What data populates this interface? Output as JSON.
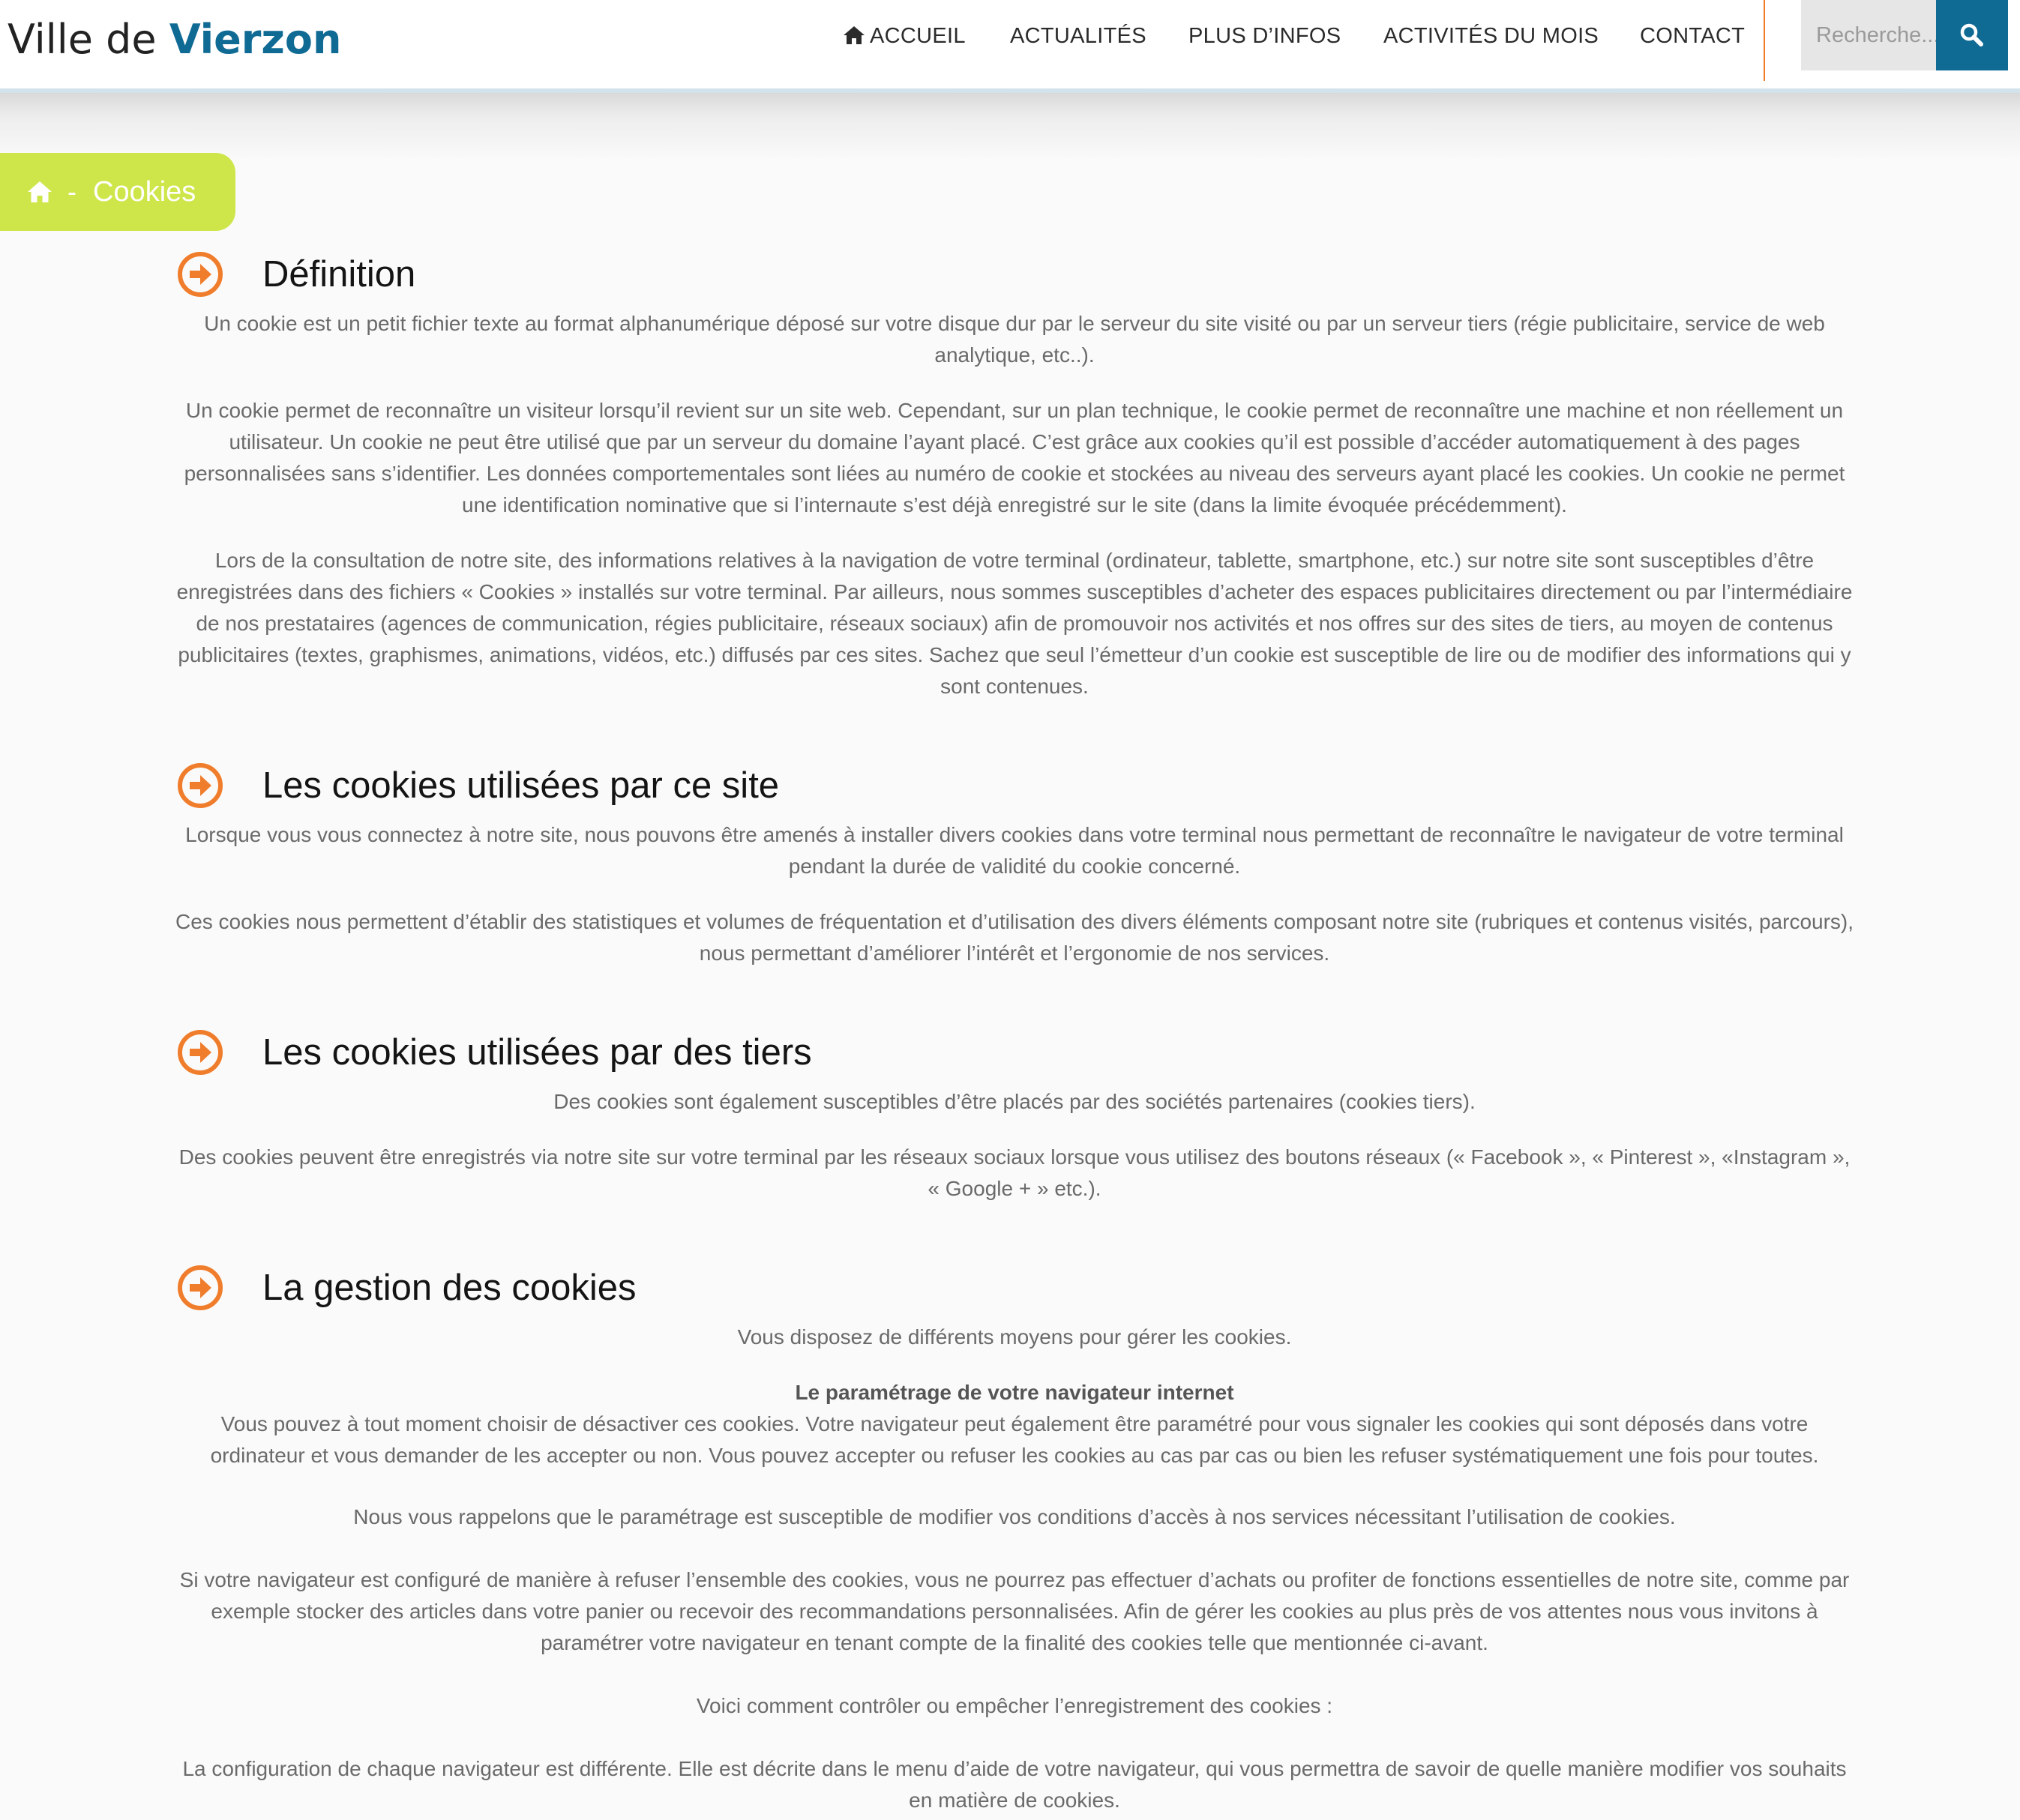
{
  "header": {
    "logo_prefix": "Ville de ",
    "logo_brand": "Vierzon",
    "nav": [
      {
        "label": "ACCUEIL",
        "icon": "home-icon"
      },
      {
        "label": "ACTUALITÉS"
      },
      {
        "label": "PLUS D’INFOS"
      },
      {
        "label": "ACTIVITÉS DU MOIS"
      },
      {
        "label": "CONTACT"
      }
    ],
    "search_placeholder": "Recherche...",
    "search_icon": "search-icon"
  },
  "breadcrumb": {
    "separator": "-",
    "current": "Cookies"
  },
  "colors": {
    "brand_blue": "#0f6a94",
    "accent_orange": "#f07d2c",
    "breadcrumb_green": "#cfe64a",
    "body_text": "#6a6a6a"
  },
  "sections": [
    {
      "title": "Définition",
      "paragraphs": [
        "Un cookie est un petit fichier texte au format alphanumérique déposé sur votre disque dur par le serveur du site visité ou par un serveur tiers (régie publicitaire, service de web analytique, etc..).",
        "Un cookie permet de reconnaître un visiteur lorsqu’il revient sur un site web. Cependant, sur un plan technique, le cookie permet de reconnaître une machine et non réellement un utilisateur. Un cookie ne peut être utilisé que par un serveur du domaine l’ayant placé. C’est grâce aux cookies qu’il est possible d’accéder automatiquement à des pages personnalisées sans s’identifier. Les données comportementales sont liées au numéro de cookie et stockées au niveau des serveurs ayant placé les cookies. Un cookie ne permet une identification nominative que si l’internaute s’est déjà enregistré sur le site (dans la limite évoquée précédemment).",
        "Lors de la consultation de notre site, des informations relatives à la navigation de votre terminal (ordinateur, tablette, smartphone, etc.) sur notre site sont susceptibles d’être enregistrées dans des fichiers « Cookies » installés sur votre terminal. Par ailleurs, nous sommes susceptibles d’acheter des espaces publicitaires directement ou par l’intermédiaire de nos prestataires (agences de communication, régies publicitaire, réseaux sociaux) afin de promouvoir nos activités et nos offres sur des sites de tiers, au moyen de contenus publicitaires (textes, graphismes, animations, vidéos, etc.) diffusés par ces sites. Sachez que seul l’émetteur d’un cookie est susceptible de lire ou de modifier des informations qui y sont contenues."
      ]
    },
    {
      "title": "Les cookies utilisées par ce site",
      "paragraphs": [
        "Lorsque vous vous connectez à notre site, nous pouvons être amenés à installer divers cookies dans votre terminal nous permettant de reconnaître le navigateur de votre terminal pendant la durée de validité du cookie concerné.",
        "Ces cookies nous permettent d’établir des statistiques et volumes de fréquentation et d’utilisation des divers éléments composant notre site (rubriques et contenus visités, parcours), nous permettant d’améliorer l’intérêt et l’ergonomie de nos services."
      ]
    },
    {
      "title": "Les cookies utilisées par des tiers",
      "paragraphs": [
        "Des cookies sont également susceptibles d’être placés par des sociétés partenaires (cookies tiers).",
        "Des cookies peuvent être enregistrés via notre site sur votre terminal par les réseaux sociaux  lorsque vous utilisez des boutons réseaux (« Facebook », « Pinterest », «Instagram », « Google + » etc.)."
      ]
    },
    {
      "title": "La gestion des cookies",
      "paragraphs": [
        "Vous disposez de différents moyens pour gérer les cookies.",
        "Le paramétrage de votre navigateur internet",
        "Vous pouvez à tout moment choisir de désactiver ces cookies. Votre navigateur peut également être paramétré pour vous signaler les cookies qui sont déposés dans votre ordinateur et vous demander de les accepter ou non. Vous pouvez accepter ou refuser les cookies au cas par cas ou bien les refuser systématiquement une fois pour toutes.",
        "Nous vous rappelons que le paramétrage est susceptible de modifier vos conditions d’accès à nos services nécessitant l’utilisation de cookies.",
        "Si votre navigateur est configuré de manière à refuser l’ensemble des cookies, vous ne pourrez pas effectuer d’achats ou profiter de fonctions essentielles de notre site, comme par exemple stocker des articles dans votre panier ou recevoir des recommandations personnalisées. Afin de gérer les cookies au plus près de vos attentes nous vous invitons à paramétrer votre navigateur en tenant compte de la finalité des cookies telle que mentionnée ci-avant.",
        "Voici comment contrôler ou empêcher l’enregistrement des cookies :",
        "La configuration de chaque navigateur est différente. Elle est décrite dans le menu d’aide de votre navigateur, qui vous permettra de savoir de quelle manière modifier vos souhaits en matière de cookies."
      ]
    }
  ]
}
